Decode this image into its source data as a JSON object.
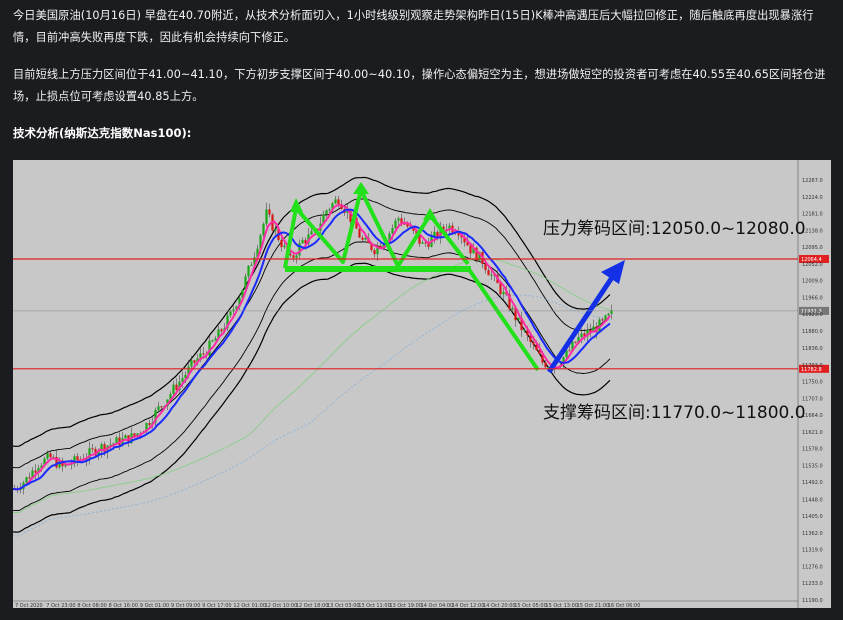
{
  "article": {
    "paragraph1": "今日美国原油(10月16日) 早盘在40.70附近，从技术分析面切入，1小时线级别观察走势架构昨日(15日)K棒冲高遇压后大幅拉回修正，随后触底再度出现暴涨行情，目前冲高失败再度下跌，因此有机会持续向下修正。",
    "paragraph2": "目前短线上方压力区间位于41.00~41.10，下方初步支撑区间于40.00~40.10，操作心态偏短空为主，想进场做短空的投资者可考虑在40.55至40.65区间轻仓进场，止损点位可考虑设置40.85上方。",
    "heading": "技术分析(纳斯达克指数Nas100):"
  },
  "chart": {
    "resistance_label": "压力筹码区间:12050.0~12080.0",
    "support_label": "支撑筹码区间:11770.0~11800.0",
    "resistance_badge": "12064.4",
    "current_badge": "11931.3",
    "support_badge": "11782.8",
    "colors": {
      "background": "#c8c8c8",
      "hline": "#e02020",
      "pattern": "#22e01a",
      "arrow": "#1430e6",
      "bollinger": "#000000",
      "ma_fast": "#ff2aa8",
      "ma_slow": "#1b2bff"
    }
  },
  "chart_data": {
    "type": "line",
    "y_ticks": [
      "12267.0",
      "12224.0",
      "12181.0",
      "12138.0",
      "12095.0",
      "12052.0",
      "12009.0",
      "11966.0",
      "11923.0",
      "11880.0",
      "11836.0",
      "11793.0",
      "11750.0",
      "11707.0",
      "11664.0",
      "11621.0",
      "11578.0",
      "11535.0",
      "11492.0",
      "11448.0",
      "11405.0",
      "11362.0",
      "11319.0",
      "11276.0",
      "11233.0",
      "11190.0"
    ],
    "x_ticks": [
      "7 Oct 2020",
      "7 Oct 23:00",
      "8 Oct 08:00",
      "8 Oct 16:00",
      "9 Oct 01:00",
      "9 Oct 09:00",
      "9 Oct 17:00",
      "12 Oct 01:00",
      "12 Oct 10:00",
      "12 Oct 18:00",
      "13 Oct 03:00",
      "13 Oct 11:00",
      "13 Oct 19:00",
      "14 Oct 04:00",
      "14 Oct 12:00",
      "14 Oct 20:00",
      "15 Oct 05:00",
      "15 Oct 13:00",
      "15 Oct 21:00",
      "16 Oct 06:00"
    ],
    "price_path": [
      [
        0,
        11475
      ],
      [
        4,
        11500
      ],
      [
        8,
        11540
      ],
      [
        12,
        11555
      ],
      [
        16,
        11530
      ],
      [
        20,
        11545
      ],
      [
        24,
        11560
      ],
      [
        28,
        11580
      ],
      [
        32,
        11590
      ],
      [
        36,
        11600
      ],
      [
        40,
        11610
      ],
      [
        44,
        11640
      ],
      [
        48,
        11680
      ],
      [
        52,
        11720
      ],
      [
        56,
        11760
      ],
      [
        60,
        11800
      ],
      [
        64,
        11830
      ],
      [
        68,
        11870
      ],
      [
        72,
        11920
      ],
      [
        76,
        11990
      ],
      [
        80,
        12080
      ],
      [
        84,
        12180
      ],
      [
        88,
        12120
      ],
      [
        92,
        12060
      ],
      [
        96,
        12110
      ],
      [
        100,
        12130
      ],
      [
        104,
        12190
      ],
      [
        108,
        12220
      ],
      [
        112,
        12170
      ],
      [
        116,
        12110
      ],
      [
        120,
        12090
      ],
      [
        124,
        12120
      ],
      [
        128,
        12170
      ],
      [
        132,
        12140
      ],
      [
        136,
        12100
      ],
      [
        140,
        12120
      ],
      [
        144,
        12150
      ],
      [
        148,
        12140
      ],
      [
        152,
        12090
      ],
      [
        156,
        12060
      ],
      [
        160,
        12010
      ],
      [
        164,
        11960
      ],
      [
        168,
        11900
      ],
      [
        172,
        11850
      ],
      [
        176,
        11800
      ],
      [
        180,
        11790
      ],
      [
        184,
        11820
      ],
      [
        188,
        11860
      ],
      [
        192,
        11880
      ],
      [
        196,
        11900
      ],
      [
        200,
        11930
      ]
    ],
    "resistance_zone": [
      12050.0,
      12080.0
    ],
    "support_zone": [
      11770.0,
      11800.0
    ]
  }
}
